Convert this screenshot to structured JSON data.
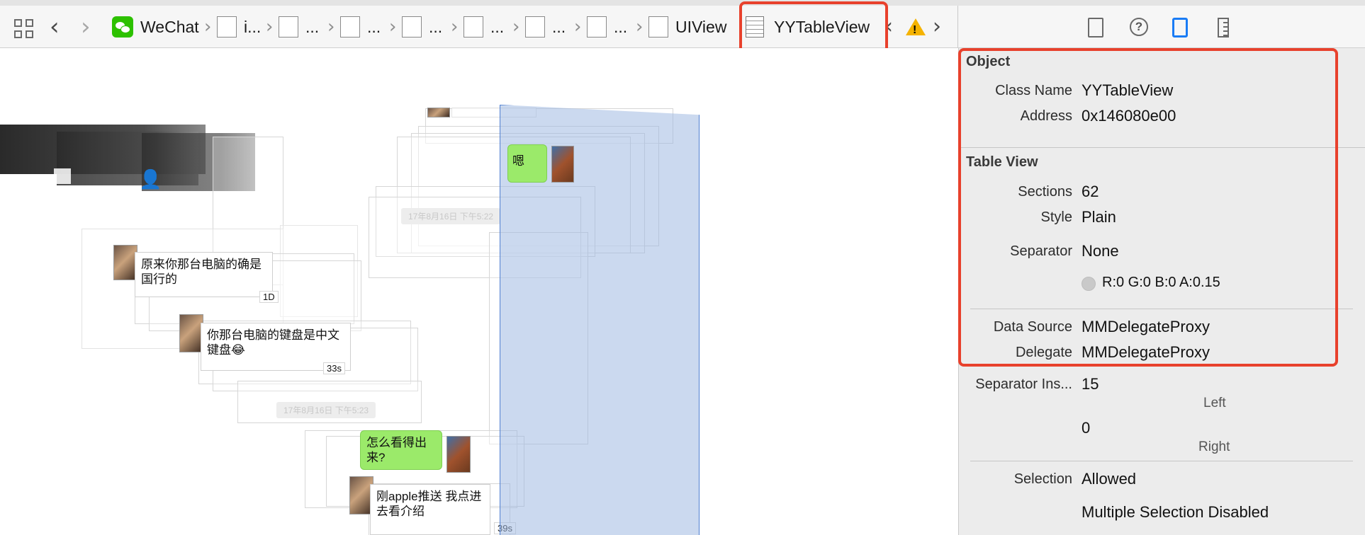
{
  "jumpbar": {
    "back_icon": "chevron-left-icon",
    "forward_icon": "chevron-right-icon",
    "crumbs": [
      "WeChat",
      "i...",
      "...",
      "...",
      "...",
      "...",
      "...",
      "...",
      "UIView",
      "YYTableView"
    ],
    "issue_prev_icon": "chevron-left-icon",
    "issue_next_icon": "chevron-right-icon",
    "warning_mark": "!"
  },
  "canvas": {
    "messages": [
      {
        "text": "嗯",
        "side": "right"
      },
      {
        "text": "原来你那台电脑的确是国行的",
        "side": "left",
        "badge": "1D"
      },
      {
        "text": "你那台电脑的键盘是中文键盘😂",
        "side": "left",
        "badge": "33s"
      },
      {
        "text": "怎么看得出来?",
        "side": "right"
      },
      {
        "text": "刚apple推送  我点进去看介绍",
        "side": "left",
        "badge": "39s"
      }
    ],
    "time_labels": [
      "17年8月16日 下午5:22",
      "17年8月16日 下午5:23"
    ]
  },
  "inspector": {
    "tabs": [
      "file-icon",
      "help-icon",
      "identity-icon",
      "size-icon"
    ],
    "object": {
      "title": "Object",
      "class_name_label": "Class Name",
      "class_name": "YYTableView",
      "address_label": "Address",
      "address": "0x146080e00"
    },
    "table_view": {
      "title": "Table View",
      "sections_label": "Sections",
      "sections": "62",
      "style_label": "Style",
      "style": "Plain",
      "separator_label": "Separator",
      "separator": "None",
      "separator_color": "R:0 G:0 B:0 A:0.15",
      "data_source_label": "Data Source",
      "data_source": "MMDelegateProxy",
      "delegate_label": "Delegate",
      "delegate": "MMDelegateProxy",
      "separator_insets_label": "Separator Ins...",
      "inset_left": "15",
      "inset_left_caption": "Left",
      "inset_right": "0",
      "inset_right_caption": "Right",
      "selection_label": "Selection",
      "selection": "Allowed",
      "multiple_selection": "Multiple Selection Disabled"
    },
    "highlight_color": "#e8412c",
    "accent_color": "#1a7cf5"
  }
}
